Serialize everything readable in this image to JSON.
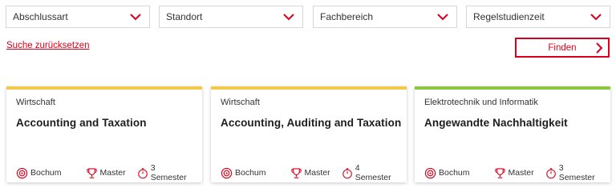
{
  "filters": [
    {
      "label": "Abschlussart"
    },
    {
      "label": "Standort"
    },
    {
      "label": "Fachbereich"
    },
    {
      "label": "Regelstudienzeit"
    }
  ],
  "actions": {
    "reset_label": "Suche zurücksetzen",
    "find_label": "Finden"
  },
  "colors": {
    "accent": "#d9001b",
    "bar_yellow": "#f2c94c",
    "bar_green": "#8cc63f"
  },
  "cards": [
    {
      "category": "Wirtschaft",
      "title": "Accounting and Taxation",
      "location": "Bochum",
      "degree": "Master",
      "duration": "3 Semester",
      "bar_color": "#f2c94c"
    },
    {
      "category": "Wirtschaft",
      "title": "Accounting, Auditing and Taxation",
      "location": "Bochum",
      "degree": "Master",
      "duration": "4 Semester",
      "bar_color": "#f2c94c"
    },
    {
      "category": "Elektrotechnik und Informatik",
      "title": "Angewandte Nachhaltigkeit",
      "location": "Bochum",
      "degree": "Master",
      "duration": "3 Semester",
      "bar_color": "#8cc63f"
    }
  ],
  "icons": {
    "filter": "chevron-down-icon",
    "find": "chevron-right-icon",
    "location": "location-target-icon",
    "degree": "trophy-icon",
    "duration": "stopwatch-icon"
  }
}
